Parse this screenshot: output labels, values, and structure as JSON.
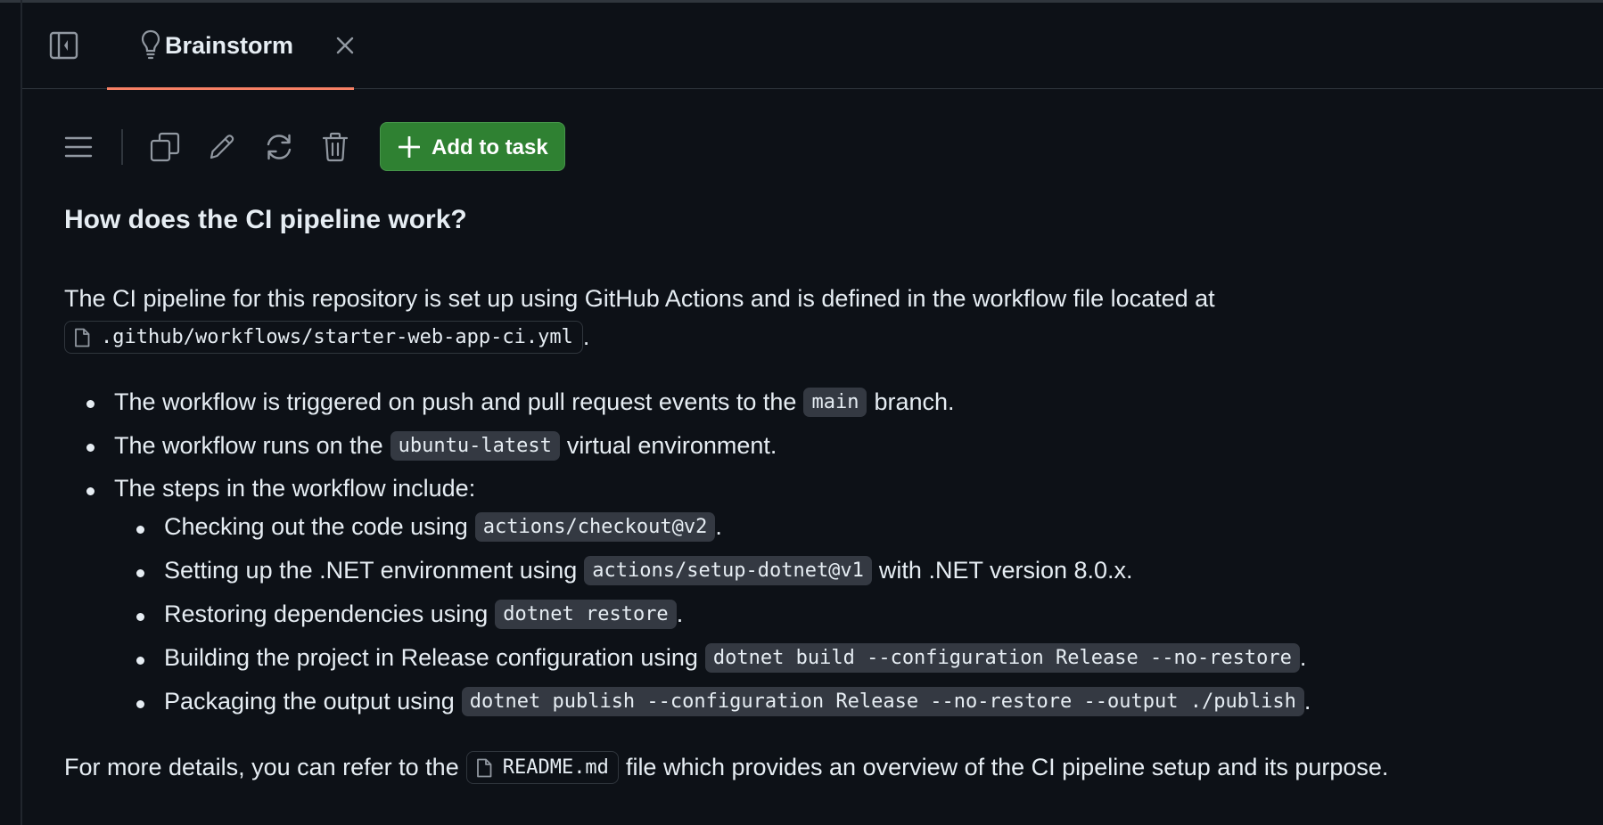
{
  "tab": {
    "label": "Brainstorm"
  },
  "toolbar": {
    "add_label": "Add to task"
  },
  "content": {
    "heading": "How does the CI pipeline work?",
    "intro": "The CI pipeline for this repository is set up using GitHub Actions and is defined in the workflow file located at",
    "workflow_file": ".github/workflows/starter-web-app-ci.yml",
    "period": ".",
    "bullets": [
      {
        "pre": "The workflow is triggered on push and pull request events to the",
        "code": "main",
        "post": "branch."
      },
      {
        "pre": "The workflow runs on the",
        "code": "ubuntu-latest",
        "post": "virtual environment."
      },
      {
        "pre": "The steps in the workflow include:"
      }
    ],
    "steps": [
      {
        "pre": "Checking out the code using",
        "code": "actions/checkout@v2",
        "post": "."
      },
      {
        "pre": "Setting up the .NET environment using",
        "code": "actions/setup-dotnet@v1",
        "post": "with .NET version 8.0.x."
      },
      {
        "pre": "Restoring dependencies using",
        "code": "dotnet restore",
        "post": "."
      },
      {
        "pre": "Building the project in Release configuration using",
        "code": "dotnet build --configuration Release --no-restore",
        "post": "."
      },
      {
        "pre": "Packaging the output using",
        "code": "dotnet publish --configuration Release --no-restore --output ./publish",
        "post": "."
      }
    ],
    "footer_pre": "For more details, you can refer to the",
    "footer_file": "README.md",
    "footer_post": "file which provides an overview of the CI pipeline setup and its purpose."
  },
  "colors": {
    "background": "#0d1117",
    "text": "#e6edf3",
    "accent_underline": "#f78166",
    "button_green": "#2f8132",
    "code_bg": "#343942"
  },
  "icons": [
    "sidebar-toggle-icon",
    "lightbulb-icon",
    "close-icon",
    "menu-icon",
    "copy-icon",
    "pencil-icon",
    "refresh-icon",
    "trash-icon",
    "plus-icon",
    "file-icon"
  ]
}
